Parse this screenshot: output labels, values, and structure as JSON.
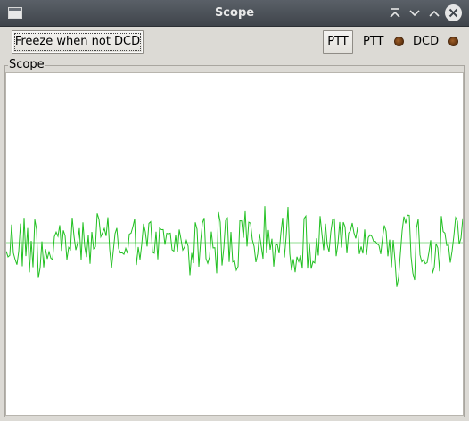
{
  "window": {
    "title": "Scope",
    "icons": {
      "app": "window-icon",
      "shade": "shade-up-icon",
      "minimize": "chevron-down-icon",
      "maximize": "chevron-up-icon",
      "close": "close-icon"
    }
  },
  "toolbar": {
    "freeze_label": "Freeze when not DCD",
    "ptt_button_label": "PTT",
    "ptt_indicator_label": "PTT",
    "dcd_indicator_label": "DCD"
  },
  "scope": {
    "group_label": "Scope",
    "trace_color": "#22c022",
    "baseline_color": "#8fdc8f"
  },
  "colors": {
    "led": "#a0602a"
  }
}
